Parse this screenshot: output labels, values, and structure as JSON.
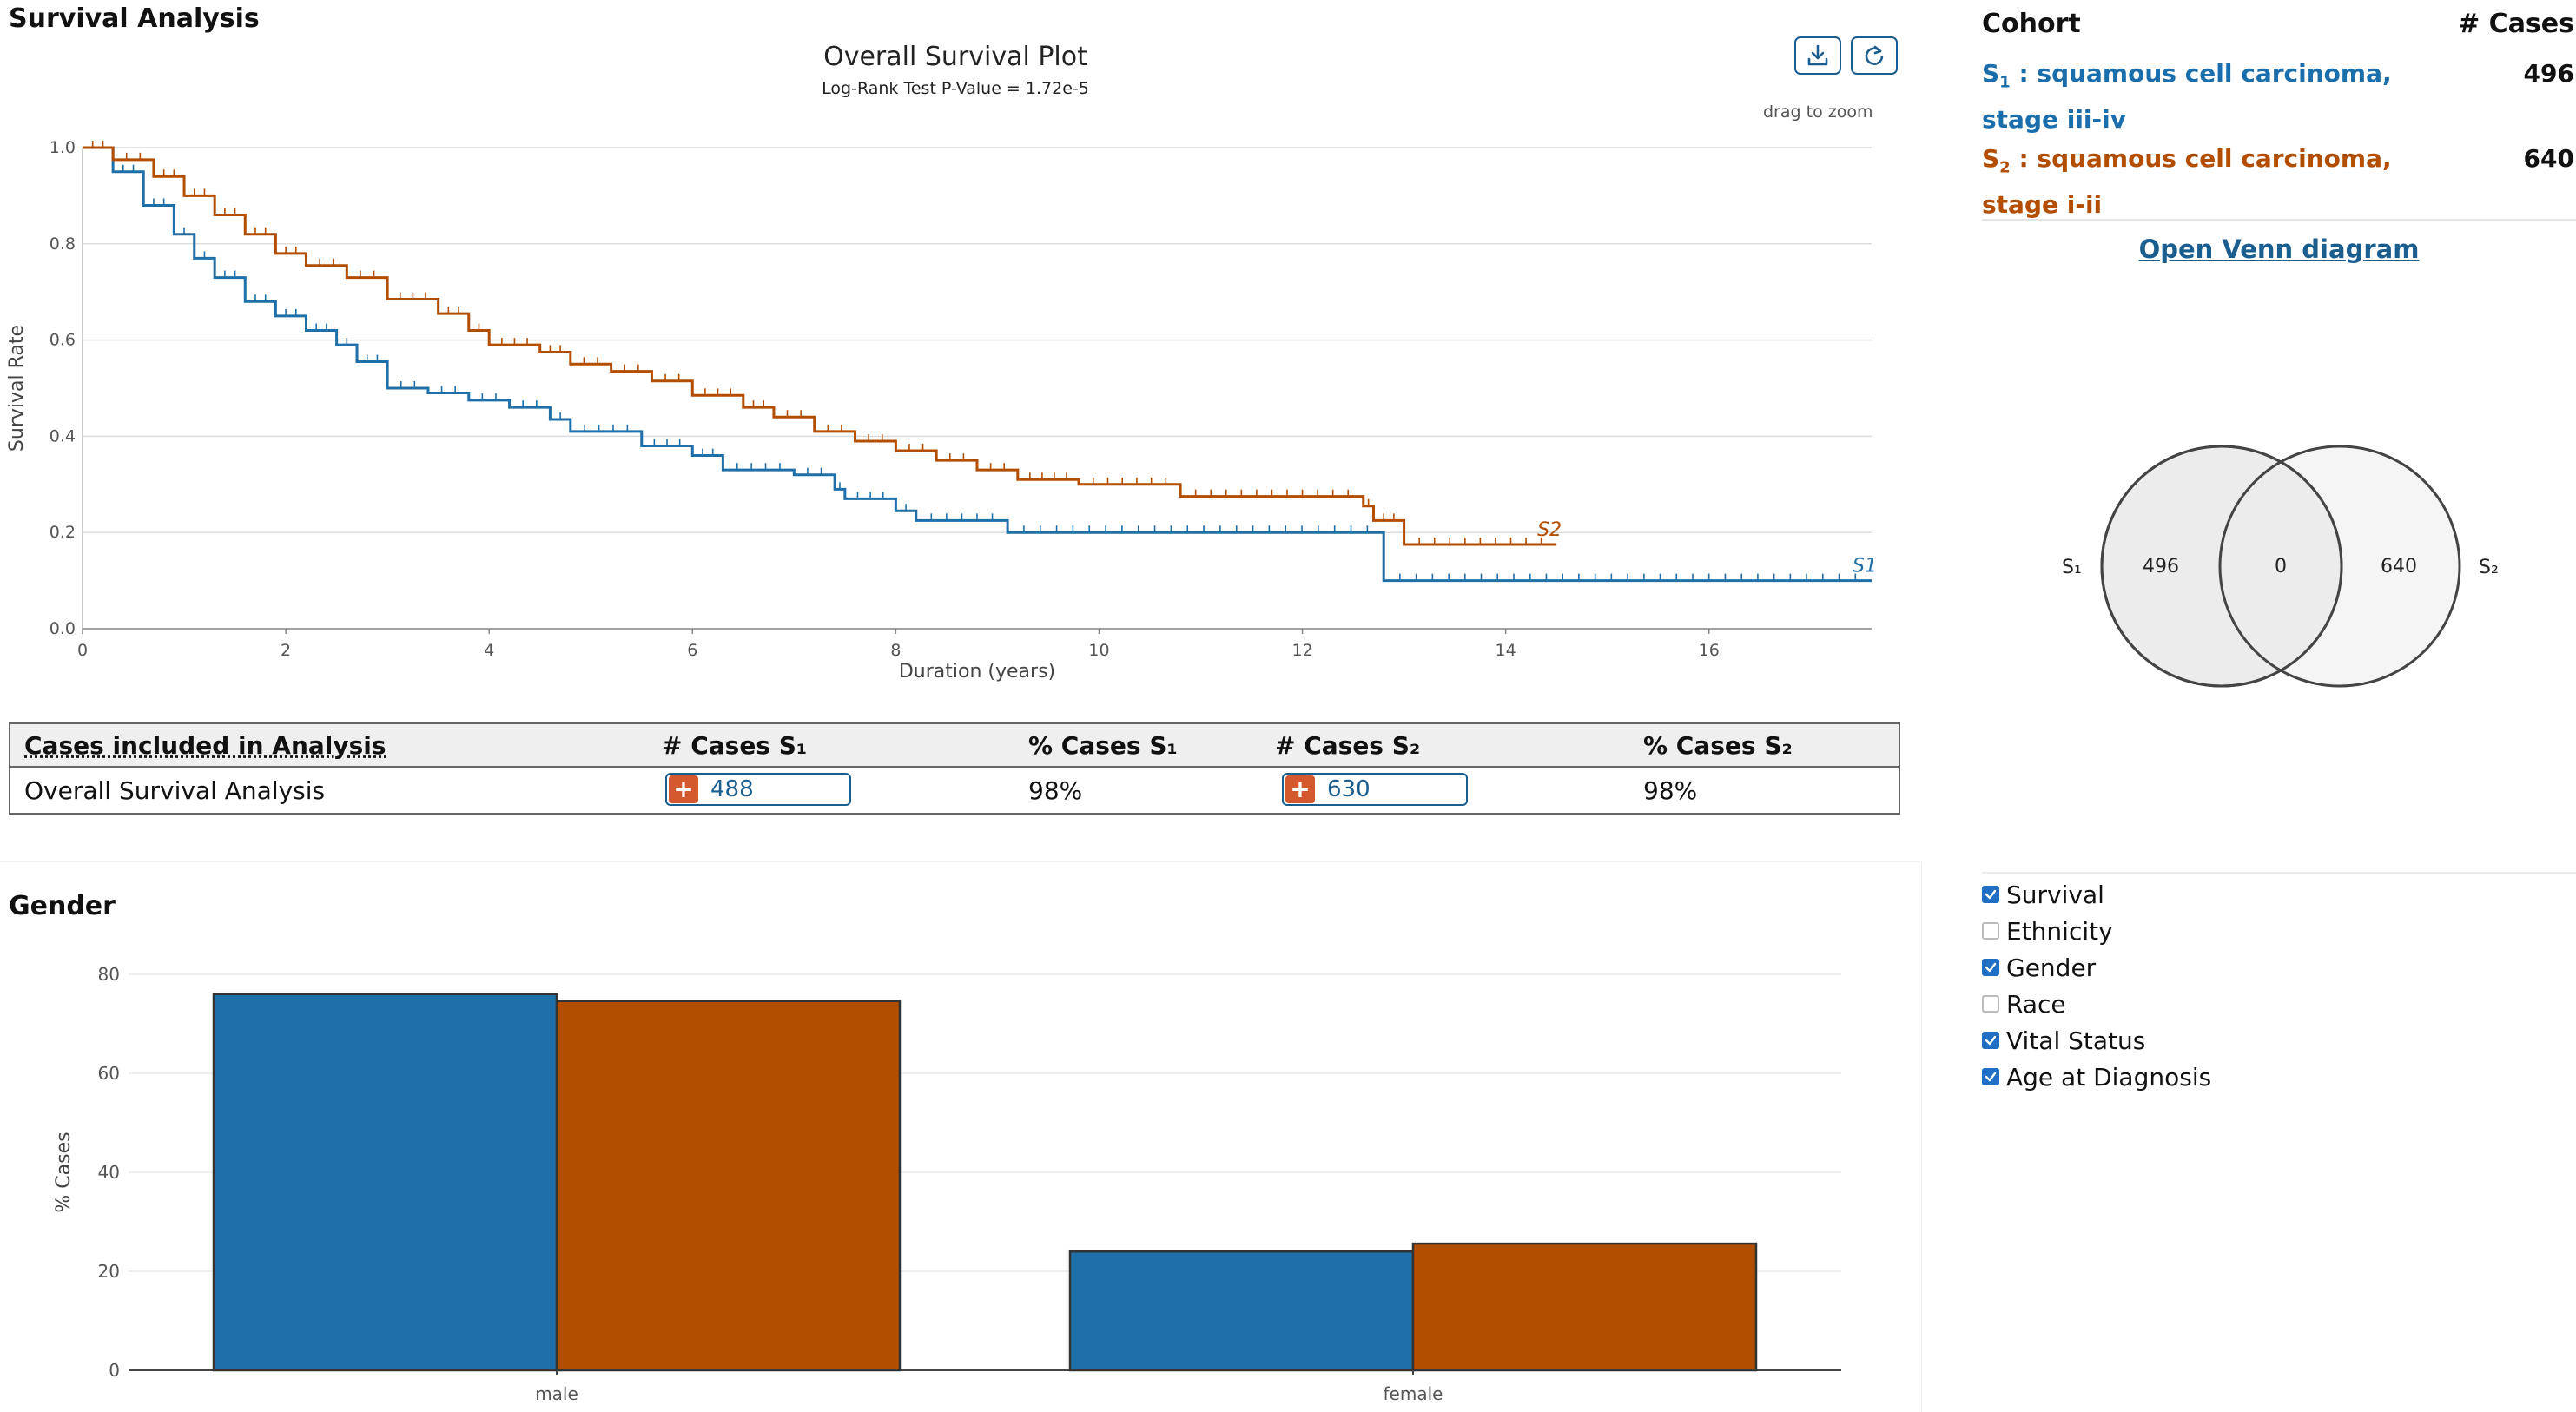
{
  "survival_section": {
    "title": "Survival Analysis",
    "plot_title": "Overall Survival Plot",
    "pvalue_text": "Log-Rank Test P-Value = 1.72e-5",
    "drag_hint": "drag to zoom",
    "download_icon": "download-icon",
    "reset_icon": "reset-icon"
  },
  "survival_chart": {
    "type": "line",
    "xlabel": "Duration (years)",
    "ylabel": "Survival Rate",
    "xlim": [
      0,
      17.6
    ],
    "ylim": [
      0,
      1.0
    ],
    "x_ticks": [
      0,
      2,
      4,
      6,
      8,
      10,
      12,
      14,
      16
    ],
    "y_ticks": [
      "0.0",
      "0.2",
      "0.4",
      "0.6",
      "0.8",
      "1.0"
    ],
    "grid": true,
    "series": [
      {
        "name": "S1",
        "color": "#1f6fa8",
        "step_points": [
          [
            0,
            1.0
          ],
          [
            0.3,
            0.95
          ],
          [
            0.6,
            0.88
          ],
          [
            0.9,
            0.82
          ],
          [
            1.1,
            0.77
          ],
          [
            1.3,
            0.73
          ],
          [
            1.6,
            0.68
          ],
          [
            1.9,
            0.65
          ],
          [
            2.2,
            0.62
          ],
          [
            2.5,
            0.59
          ],
          [
            2.7,
            0.555
          ],
          [
            3.0,
            0.5
          ],
          [
            3.4,
            0.49
          ],
          [
            3.8,
            0.475
          ],
          [
            4.2,
            0.46
          ],
          [
            4.6,
            0.435
          ],
          [
            4.8,
            0.41
          ],
          [
            5.5,
            0.38
          ],
          [
            6.0,
            0.36
          ],
          [
            6.3,
            0.33
          ],
          [
            7.0,
            0.32
          ],
          [
            7.4,
            0.29
          ],
          [
            7.5,
            0.27
          ],
          [
            8.0,
            0.245
          ],
          [
            8.2,
            0.225
          ],
          [
            9.1,
            0.2
          ],
          [
            12.8,
            0.1
          ],
          [
            17.6,
            0.1
          ]
        ],
        "end_label": "S1"
      },
      {
        "name": "S2",
        "color": "#b34d00",
        "step_points": [
          [
            0,
            1.0
          ],
          [
            0.3,
            0.975
          ],
          [
            0.7,
            0.94
          ],
          [
            1.0,
            0.9
          ],
          [
            1.3,
            0.86
          ],
          [
            1.6,
            0.82
          ],
          [
            1.9,
            0.78
          ],
          [
            2.2,
            0.755
          ],
          [
            2.6,
            0.73
          ],
          [
            3.0,
            0.685
          ],
          [
            3.5,
            0.655
          ],
          [
            3.8,
            0.62
          ],
          [
            4.0,
            0.59
          ],
          [
            4.5,
            0.575
          ],
          [
            4.8,
            0.55
          ],
          [
            5.2,
            0.535
          ],
          [
            5.6,
            0.515
          ],
          [
            6.0,
            0.485
          ],
          [
            6.5,
            0.46
          ],
          [
            6.8,
            0.44
          ],
          [
            7.2,
            0.41
          ],
          [
            7.6,
            0.39
          ],
          [
            8.0,
            0.37
          ],
          [
            8.4,
            0.35
          ],
          [
            8.8,
            0.33
          ],
          [
            9.2,
            0.31
          ],
          [
            9.8,
            0.3
          ],
          [
            10.8,
            0.275
          ],
          [
            12.6,
            0.255
          ],
          [
            12.7,
            0.225
          ],
          [
            13.0,
            0.175
          ],
          [
            14.5,
            0.175
          ]
        ],
        "end_label": "S2"
      }
    ]
  },
  "cases_table": {
    "headers": {
      "label": "Cases included in Analysis",
      "cases_s1": "# Cases S₁",
      "pct_s1": "% Cases S₁",
      "cases_s2": "# Cases S₂",
      "pct_s2": "% Cases S₂"
    },
    "row": {
      "label": "Overall Survival Analysis",
      "cases_s1": "488",
      "pct_s1": "98%",
      "cases_s2": "630",
      "pct_s2": "98%"
    },
    "add_icon": "plus-icon"
  },
  "cohort_panel": {
    "header_cohort": "Cohort",
    "header_cases": "# Cases",
    "s1_prefix": "S",
    "s1_sub": "1",
    "s1_label": " : squamous cell carcinoma, stage iii-iv",
    "s1_count": "496",
    "s2_prefix": "S",
    "s2_sub": "2",
    "s2_label": " : squamous cell carcinoma, stage i-ii",
    "s2_count": "640",
    "venn_link": "Open Venn diagram",
    "s1_color": "#1a6eab",
    "s2_color": "#b34d00"
  },
  "venn": {
    "left_label": "S₁",
    "right_label": "S₂",
    "left_only": "496",
    "intersection": "0",
    "right_only": "640"
  },
  "gender_section": {
    "title": "Gender"
  },
  "chart_data": {
    "type": "bar",
    "title": "Gender",
    "categories": [
      "male",
      "female"
    ],
    "series": [
      {
        "color": "#1f6fa8",
        "values": [
          76,
          24
        ]
      },
      {
        "color": "#b34d00",
        "values": [
          74.6,
          25.6
        ]
      }
    ],
    "xlabel": "",
    "ylabel": "% Cases",
    "ylim": [
      0,
      80
    ],
    "y_ticks": [
      0,
      20,
      40,
      60,
      80
    ],
    "grid": true
  },
  "facets": [
    {
      "label": "Survival",
      "checked": true
    },
    {
      "label": "Ethnicity",
      "checked": false
    },
    {
      "label": "Gender",
      "checked": true
    },
    {
      "label": "Race",
      "checked": false
    },
    {
      "label": "Vital Status",
      "checked": true
    },
    {
      "label": "Age at Diagnosis",
      "checked": true
    }
  ]
}
